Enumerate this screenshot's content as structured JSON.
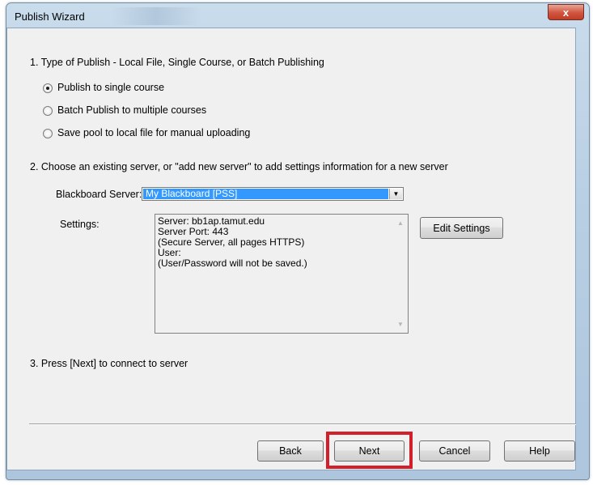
{
  "window": {
    "title": "Publish Wizard",
    "close_glyph": "x"
  },
  "step1": {
    "heading": "1. Type of Publish - Local File, Single Course, or Batch Publishing",
    "options": [
      {
        "label": "Publish to single course",
        "checked": true
      },
      {
        "label": "Batch Publish to multiple courses",
        "checked": false
      },
      {
        "label": "Save pool to local file for manual uploading",
        "checked": false
      }
    ]
  },
  "step2": {
    "heading": "2. Choose an existing server, or \"add new server\" to add settings information for a new server",
    "server_label": "Blackboard Server:",
    "server_value": "My Blackboard [PSS]",
    "settings_label": "Settings:",
    "settings_lines": [
      "Server: bb1ap.tamut.edu",
      "Server Port: 443",
      "(Secure Server, all pages HTTPS)",
      "User:",
      "(User/Password will not be saved.)"
    ],
    "edit_settings_label": "Edit Settings"
  },
  "step3": {
    "heading": "3. Press [Next] to connect to server"
  },
  "buttons": {
    "back": "Back",
    "next": "Next",
    "cancel": "Cancel",
    "help": "Help"
  },
  "colors": {
    "highlight": "#d21f2a",
    "selection": "#3399ff",
    "close": "#c03d25"
  },
  "icons": {
    "dropdown": "chevron-down-icon",
    "close": "close-icon"
  }
}
